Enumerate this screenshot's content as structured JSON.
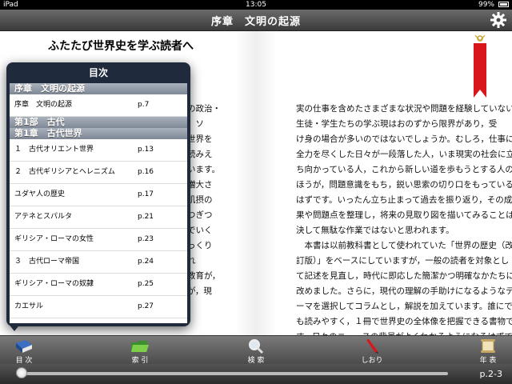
{
  "status": {
    "device": "iPad",
    "time": "13:05",
    "battery": "99%"
  },
  "nav": {
    "title": "序章　文明の起源"
  },
  "page": {
    "left_title": "ふたたび世界史を学ぶ読者へ",
    "left_fragment": "の政治・\n。ソ\n世界を\n読みえ\nいます。\n増大さ\n肌摂の\nつぎつ\nでいく\nっくり\nれ\n教育が，\nが，現",
    "right_text": "実の仕事を含めたさまざまな状況や問題を経験していない\n生徒・学生たちの学ぶ現はおのずから限界があり，受\nけ身の場合が多いのではないでしょうか。むしろ，仕事に\n全力を尽くした日々が一段落した人，いま現実の社会に立\nち向かっている人，これから新しい道を歩もうとする人の\nほうが，問題意識をもち，鋭い思索の切り口をもっている\nはずです。いったん立ち止まって過去を振り返り，その成\n果や問題点を整理し，将来の見取り図を描いてみることは\n決して無駄な作業ではないと思われます。\n　本書は以前教科書として使われていた「世界の歴史（改\n訂版）」をベースにしていますが，一般の読者を対象とし\nて記述を見直し，時代に即応した簡潔かつ明確なかたちに\n改めました。さらに，現代の理解の手助けになるようなテ\nーマを選択してコラムとし，解説を加えています。誰にで\nも読みやすく，１冊で世界史の全体像を把握できる書物で\nす。日々のニュースの背景がよくわかるようになるはずで\nす。本書が歴史のみちすじの理解と，将来像の構築の一助\nとなることを願っています。"
  },
  "toc": {
    "title": "目次",
    "sections": [
      {
        "heading": "序章　文明の起源",
        "items": [
          {
            "label": "序章　文明の起源",
            "page": "p.7"
          }
        ]
      },
      {
        "heading": "第1部　古代",
        "items": []
      },
      {
        "heading": "第1章　古代世界",
        "items": [
          {
            "label": "１　古代オリエント世界",
            "page": "p.13"
          },
          {
            "label": "２　古代ギリシアとヘレニズム",
            "page": "p.16"
          },
          {
            "label": "ユダヤ人の歴史",
            "page": "p.17"
          },
          {
            "label": "アテネとスパルタ",
            "page": "p.21"
          },
          {
            "label": "ギリシア・ローマの女性",
            "page": "p.23"
          },
          {
            "label": "３　古代ローマ帝国",
            "page": "p.24"
          },
          {
            "label": "ギリシア・ローマの奴隷",
            "page": "p.25"
          },
          {
            "label": "カエサル",
            "page": "p.27"
          }
        ]
      }
    ]
  },
  "toolbar": {
    "items": [
      {
        "label": "目 次",
        "icon": "book-icon"
      },
      {
        "label": "索 引",
        "icon": "folder-icon"
      },
      {
        "label": "検 索",
        "icon": "magnifier-icon"
      },
      {
        "label": "しおり",
        "icon": "pen-icon"
      },
      {
        "label": "年 表",
        "icon": "scroll-icon"
      }
    ]
  },
  "slider": {
    "progress": 0.0,
    "page_label": "p.2-3"
  },
  "colors": {
    "bookmark": "#d9161c",
    "popover": "#1f2a3c"
  }
}
